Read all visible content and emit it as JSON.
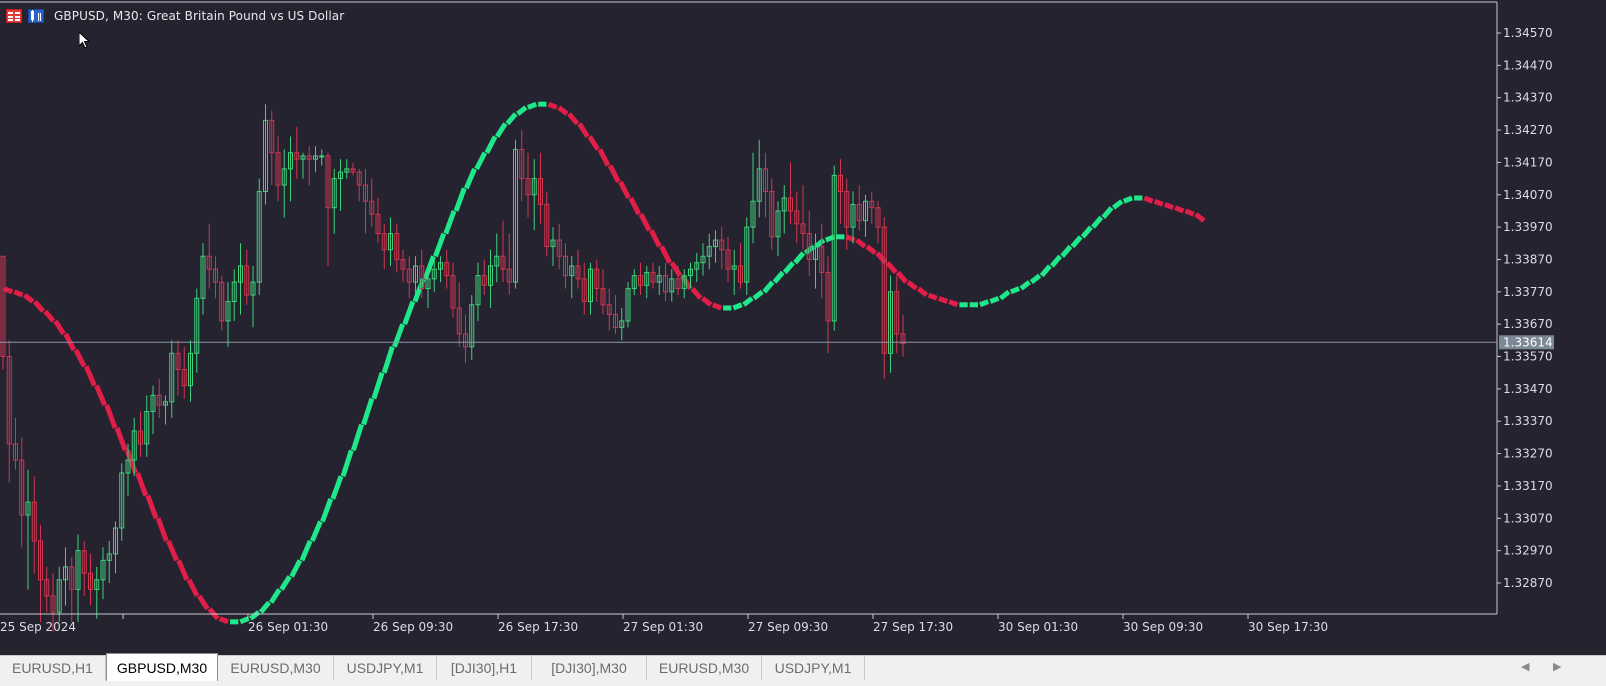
{
  "window": {
    "title": "GBPUSD, M30:  Great Britain Pound vs US Dollar"
  },
  "colors": {
    "background": "#262331",
    "bull_candle": "#3ed07a",
    "bear_candle": "#d0344e",
    "hull_up": "#1ee88a",
    "hull_down": "#e01e48",
    "grid_axis": "#c8c8d0",
    "bid_line": "#8a98a8",
    "price_tag_bg": "#7d8896"
  },
  "axis": {
    "price_labels": [
      "1.34570",
      "1.34470",
      "1.34370",
      "1.34270",
      "1.34170",
      "1.34070",
      "1.33970",
      "1.33870",
      "1.33770",
      "1.33670",
      "1.33570",
      "1.33470",
      "1.33370",
      "1.33270",
      "1.33170",
      "1.33070",
      "1.32970",
      "1.32870"
    ],
    "time_labels": [
      "25 Sep 2024",
      "26 Sep 01:30",
      "26 Sep 09:30",
      "26 Sep 17:30",
      "27 Sep 01:30",
      "27 Sep 09:30",
      "27 Sep 17:30",
      "30 Sep 01:30",
      "30 Sep 09:30",
      "30 Sep 17:30"
    ],
    "current_price": "1.33614"
  },
  "tabs": [
    {
      "label": "EURUSD,H1",
      "active": false
    },
    {
      "label": "GBPUSD,M30",
      "active": true
    },
    {
      "label": "EURUSD,M30",
      "active": false
    },
    {
      "label": "USDJPY,M1",
      "active": false
    },
    {
      "label": "[DJI30],H1",
      "active": false
    },
    {
      "label": "[DJI30],M30",
      "active": false
    },
    {
      "label": "EURUSD,M30",
      "active": false
    },
    {
      "label": "USDJPY,M1",
      "active": false
    }
  ],
  "chart_data": {
    "type": "candlestick",
    "symbol": "GBPUSD",
    "timeframe": "M30",
    "current_price": 1.33614,
    "ylim": [
      1.3277,
      1.3465
    ],
    "grid": false,
    "candles": [
      [
        1.3388,
        1.3388,
        1.3353,
        1.3357
      ],
      [
        1.3357,
        1.3362,
        1.3318,
        1.333
      ],
      [
        1.333,
        1.3338,
        1.3322,
        1.3325
      ],
      [
        1.3325,
        1.3332,
        1.3298,
        1.3308
      ],
      [
        1.3308,
        1.3322,
        1.3285,
        1.3312
      ],
      [
        1.3312,
        1.332,
        1.329,
        1.33
      ],
      [
        1.33,
        1.3305,
        1.3275,
        1.3288
      ],
      [
        1.3288,
        1.3292,
        1.3278,
        1.3283
      ],
      [
        1.3283,
        1.329,
        1.3272,
        1.3278
      ],
      [
        1.3278,
        1.3292,
        1.3275,
        1.3288
      ],
      [
        1.3288,
        1.3298,
        1.328,
        1.3292
      ],
      [
        1.3292,
        1.3295,
        1.3275,
        1.3285
      ],
      [
        1.3285,
        1.3302,
        1.3275,
        1.3297
      ],
      [
        1.3297,
        1.33,
        1.3283,
        1.329
      ],
      [
        1.329,
        1.3296,
        1.328,
        1.3285
      ],
      [
        1.3285,
        1.3292,
        1.3276,
        1.3288
      ],
      [
        1.3288,
        1.3298,
        1.3282,
        1.3294
      ],
      [
        1.3294,
        1.33,
        1.3287,
        1.3296
      ],
      [
        1.3296,
        1.3306,
        1.329,
        1.3304
      ],
      [
        1.3304,
        1.3324,
        1.33,
        1.3321
      ],
      [
        1.3321,
        1.333,
        1.3314,
        1.3325
      ],
      [
        1.3325,
        1.3338,
        1.332,
        1.3334
      ],
      [
        1.3334,
        1.334,
        1.3326,
        1.333
      ],
      [
        1.333,
        1.3345,
        1.3326,
        1.334
      ],
      [
        1.334,
        1.3348,
        1.3333,
        1.3345
      ],
      [
        1.3345,
        1.335,
        1.3338,
        1.3342
      ],
      [
        1.3342,
        1.3345,
        1.3336,
        1.3343
      ],
      [
        1.3343,
        1.3362,
        1.3338,
        1.3358
      ],
      [
        1.3358,
        1.3362,
        1.3345,
        1.3353
      ],
      [
        1.3353,
        1.336,
        1.3344,
        1.3348
      ],
      [
        1.3348,
        1.3362,
        1.3343,
        1.3358
      ],
      [
        1.3358,
        1.3378,
        1.3352,
        1.3375
      ],
      [
        1.3375,
        1.3392,
        1.337,
        1.3388
      ],
      [
        1.3388,
        1.3398,
        1.3378,
        1.3384
      ],
      [
        1.3384,
        1.3388,
        1.3375,
        1.338
      ],
      [
        1.338,
        1.3382,
        1.3365,
        1.3368
      ],
      [
        1.3368,
        1.338,
        1.336,
        1.3374
      ],
      [
        1.3374,
        1.3384,
        1.3368,
        1.338
      ],
      [
        1.338,
        1.3392,
        1.337,
        1.3385
      ],
      [
        1.3385,
        1.339,
        1.3373,
        1.3376
      ],
      [
        1.3376,
        1.3385,
        1.3366,
        1.338
      ],
      [
        1.338,
        1.3412,
        1.3376,
        1.3408
      ],
      [
        1.3408,
        1.3435,
        1.3404,
        1.343
      ],
      [
        1.343,
        1.3433,
        1.341,
        1.342
      ],
      [
        1.342,
        1.3425,
        1.3405,
        1.341
      ],
      [
        1.341,
        1.3421,
        1.34,
        1.3415
      ],
      [
        1.3415,
        1.3425,
        1.3405,
        1.342
      ],
      [
        1.342,
        1.3428,
        1.3412,
        1.3418
      ],
      [
        1.3418,
        1.342,
        1.3412,
        1.3419
      ],
      [
        1.3419,
        1.3422,
        1.341,
        1.3418
      ],
      [
        1.3418,
        1.3422,
        1.3414,
        1.3419
      ],
      [
        1.3419,
        1.3421,
        1.3416,
        1.3419
      ],
      [
        1.3419,
        1.342,
        1.3385,
        1.3403
      ],
      [
        1.3403,
        1.3415,
        1.3395,
        1.3412
      ],
      [
        1.3412,
        1.3418,
        1.3402,
        1.3414
      ],
      [
        1.3414,
        1.3418,
        1.3412,
        1.3415
      ],
      [
        1.3415,
        1.3417,
        1.3413,
        1.3414
      ],
      [
        1.3414,
        1.3415,
        1.3405,
        1.341
      ],
      [
        1.341,
        1.3415,
        1.3395,
        1.3405
      ],
      [
        1.3405,
        1.3412,
        1.3397,
        1.3401
      ],
      [
        1.3401,
        1.3406,
        1.3392,
        1.3395
      ],
      [
        1.3395,
        1.3398,
        1.3384,
        1.339
      ],
      [
        1.339,
        1.34,
        1.3385,
        1.3395
      ],
      [
        1.3395,
        1.3398,
        1.3383,
        1.3387
      ],
      [
        1.3387,
        1.339,
        1.338,
        1.3384
      ],
      [
        1.3384,
        1.3388,
        1.3375,
        1.338
      ],
      [
        1.338,
        1.3388,
        1.3376,
        1.3385
      ],
      [
        1.3385,
        1.339,
        1.3375,
        1.3378
      ],
      [
        1.3378,
        1.3385,
        1.3372,
        1.3381
      ],
      [
        1.3381,
        1.3387,
        1.3377,
        1.3384
      ],
      [
        1.3384,
        1.3388,
        1.338,
        1.3386
      ],
      [
        1.3386,
        1.339,
        1.3378,
        1.3382
      ],
      [
        1.3382,
        1.3386,
        1.3369,
        1.3372
      ],
      [
        1.3372,
        1.338,
        1.336,
        1.3364
      ],
      [
        1.3364,
        1.337,
        1.3355,
        1.336
      ],
      [
        1.336,
        1.3376,
        1.3356,
        1.3373
      ],
      [
        1.3373,
        1.3386,
        1.3368,
        1.3382
      ],
      [
        1.3382,
        1.3387,
        1.3376,
        1.3379
      ],
      [
        1.3379,
        1.339,
        1.3372,
        1.3385
      ],
      [
        1.3385,
        1.3395,
        1.338,
        1.3388
      ],
      [
        1.3388,
        1.3399,
        1.338,
        1.3384
      ],
      [
        1.3384,
        1.3395,
        1.3376,
        1.338
      ],
      [
        1.338,
        1.3424,
        1.3378,
        1.3421
      ],
      [
        1.3421,
        1.3427,
        1.3405,
        1.3412
      ],
      [
        1.3412,
        1.342,
        1.34,
        1.3407
      ],
      [
        1.3407,
        1.3418,
        1.3396,
        1.3412
      ],
      [
        1.3412,
        1.342,
        1.3398,
        1.3404
      ],
      [
        1.3404,
        1.3408,
        1.3388,
        1.3391
      ],
      [
        1.3391,
        1.3397,
        1.3385,
        1.3393
      ],
      [
        1.3393,
        1.3398,
        1.3384,
        1.3388
      ],
      [
        1.3388,
        1.3392,
        1.3378,
        1.3382
      ],
      [
        1.3382,
        1.3388,
        1.3375,
        1.3385
      ],
      [
        1.3385,
        1.339,
        1.3378,
        1.3381
      ],
      [
        1.3381,
        1.3386,
        1.337,
        1.3374
      ],
      [
        1.3374,
        1.3386,
        1.337,
        1.3384
      ],
      [
        1.3384,
        1.3387,
        1.3374,
        1.3378
      ],
      [
        1.3378,
        1.3384,
        1.337,
        1.3373
      ],
      [
        1.3373,
        1.3378,
        1.3365,
        1.337
      ],
      [
        1.337,
        1.3376,
        1.3364,
        1.3366
      ],
      [
        1.3366,
        1.3372,
        1.3362,
        1.3368
      ],
      [
        1.3368,
        1.338,
        1.3366,
        1.3378
      ],
      [
        1.3378,
        1.3384,
        1.3376,
        1.3382
      ],
      [
        1.3382,
        1.3386,
        1.3376,
        1.3379
      ],
      [
        1.3379,
        1.3385,
        1.3375,
        1.3383
      ],
      [
        1.3383,
        1.3386,
        1.3378,
        1.338
      ],
      [
        1.338,
        1.3385,
        1.3376,
        1.3382
      ],
      [
        1.3382,
        1.3386,
        1.3374,
        1.3377
      ],
      [
        1.3377,
        1.3384,
        1.3374,
        1.3381
      ],
      [
        1.3381,
        1.3385,
        1.3376,
        1.3378
      ],
      [
        1.3378,
        1.3384,
        1.3375,
        1.3382
      ],
      [
        1.3382,
        1.3386,
        1.3378,
        1.3384
      ],
      [
        1.3384,
        1.3389,
        1.338,
        1.3386
      ],
      [
        1.3386,
        1.3392,
        1.3382,
        1.3388
      ],
      [
        1.3388,
        1.3395,
        1.3384,
        1.3391
      ],
      [
        1.3391,
        1.3396,
        1.3386,
        1.3393
      ],
      [
        1.3393,
        1.3397,
        1.3384,
        1.339
      ],
      [
        1.339,
        1.3394,
        1.338,
        1.3384
      ],
      [
        1.3384,
        1.339,
        1.3376,
        1.3385
      ],
      [
        1.3385,
        1.3392,
        1.3378,
        1.338
      ],
      [
        1.338,
        1.34,
        1.3376,
        1.3397
      ],
      [
        1.3397,
        1.342,
        1.3392,
        1.3405
      ],
      [
        1.3405,
        1.3424,
        1.34,
        1.3415
      ],
      [
        1.3415,
        1.342,
        1.34,
        1.3408
      ],
      [
        1.3408,
        1.3412,
        1.339,
        1.3394
      ],
      [
        1.3394,
        1.3405,
        1.3388,
        1.3402
      ],
      [
        1.3402,
        1.341,
        1.3395,
        1.3406
      ],
      [
        1.3406,
        1.3417,
        1.3398,
        1.3402
      ],
      [
        1.3402,
        1.3408,
        1.3392,
        1.3398
      ],
      [
        1.3398,
        1.341,
        1.339,
        1.3395
      ],
      [
        1.3395,
        1.3402,
        1.3382,
        1.3387
      ],
      [
        1.3387,
        1.3395,
        1.3378,
        1.3391
      ],
      [
        1.3391,
        1.3398,
        1.3375,
        1.3383
      ],
      [
        1.3383,
        1.3388,
        1.3358,
        1.3368
      ],
      [
        1.3368,
        1.3416,
        1.3365,
        1.3413
      ],
      [
        1.3413,
        1.3418,
        1.3398,
        1.3408
      ],
      [
        1.3408,
        1.3412,
        1.339,
        1.3397
      ],
      [
        1.3397,
        1.3408,
        1.3392,
        1.3404
      ],
      [
        1.3404,
        1.341,
        1.3396,
        1.3399
      ],
      [
        1.3399,
        1.3407,
        1.3394,
        1.3405
      ],
      [
        1.3405,
        1.3408,
        1.3398,
        1.3403
      ],
      [
        1.3403,
        1.3405,
        1.3392,
        1.3397
      ],
      [
        1.3397,
        1.34,
        1.335,
        1.3358
      ],
      [
        1.3358,
        1.3382,
        1.3352,
        1.3377
      ],
      [
        1.3377,
        1.3382,
        1.3358,
        1.3364
      ],
      [
        1.3364,
        1.337,
        1.3357,
        1.3361
      ]
    ],
    "hull_ma": {
      "type": "line",
      "values": [
        1.3378,
        1.3377,
        1.3376,
        1.3374,
        1.3371,
        1.3368,
        1.3364,
        1.3359,
        1.3354,
        1.3348,
        1.3342,
        1.3335,
        1.3328,
        1.3321,
        1.3314,
        1.3307,
        1.33,
        1.3294,
        1.3288,
        1.3283,
        1.3279,
        1.3276,
        1.3275,
        1.3275,
        1.3276,
        1.3278,
        1.3281,
        1.3285,
        1.3289,
        1.3294,
        1.33,
        1.3306,
        1.3313,
        1.332,
        1.3328,
        1.3336,
        1.3344,
        1.3352,
        1.336,
        1.3367,
        1.3374,
        1.3381,
        1.3388,
        1.3395,
        1.3402,
        1.3409,
        1.3415,
        1.342,
        1.3425,
        1.3429,
        1.3432,
        1.3434,
        1.3435,
        1.3435,
        1.3434,
        1.3432,
        1.3429,
        1.3425,
        1.3421,
        1.3416,
        1.3411,
        1.3406,
        1.3401,
        1.3396,
        1.3391,
        1.3386,
        1.3382,
        1.3378,
        1.3375,
        1.3373,
        1.3372,
        1.3372,
        1.3373,
        1.3375,
        1.3377,
        1.338,
        1.3383,
        1.3386,
        1.3389,
        1.3391,
        1.3393,
        1.3394,
        1.3394,
        1.3393,
        1.3391,
        1.3389,
        1.3386,
        1.3383,
        1.338,
        1.3378,
        1.3376,
        1.3375,
        1.3374,
        1.3373,
        1.3373,
        1.3373,
        1.3374,
        1.3375,
        1.3377,
        1.3378,
        1.338,
        1.3382,
        1.3385,
        1.3388,
        1.3391,
        1.3394,
        1.3397,
        1.34,
        1.3403,
        1.3405,
        1.3406,
        1.3406,
        1.3405,
        1.3404,
        1.3403,
        1.3402,
        1.3401,
        1.3399
      ]
    }
  }
}
